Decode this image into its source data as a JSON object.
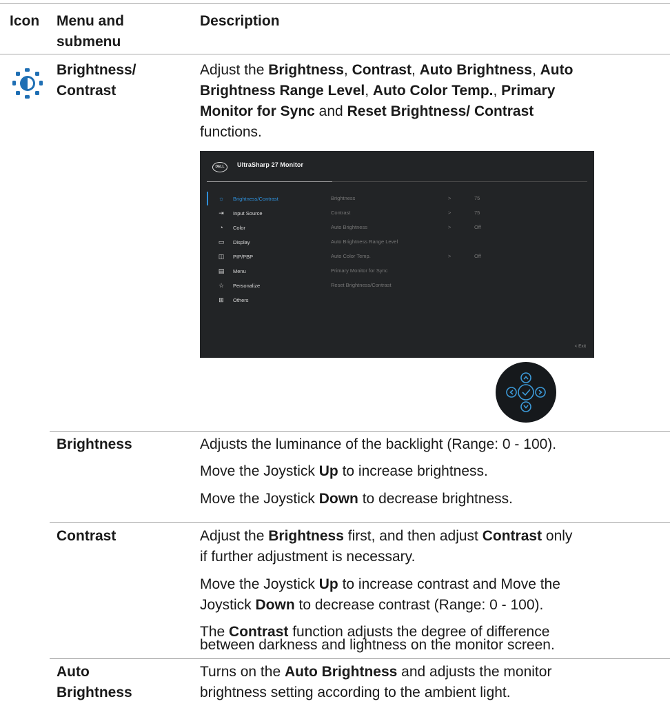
{
  "table": {
    "header_icon": "Icon",
    "header_menu": "Menu and submenu",
    "header_desc": "Description"
  },
  "main": {
    "icon": "brightness-contrast-icon",
    "name_line1": "Brightness/",
    "name_line2": "Contrast",
    "desc": {
      "l1_a": "Adjust the ",
      "l1_b": "Brightness",
      "l1_c": ", ",
      "l1_d": "Contrast",
      "l1_e": ", ",
      "l1_f": "Auto Brightness",
      "l1_g": ", ",
      "l1_h": "Auto",
      "l2_a": "Brightness Range Level",
      "l2_b": ", ",
      "l2_c": "Auto Color Temp.",
      "l2_d": ", ",
      "l2_e": "Primary",
      "l3_a": "Monitor for Sync",
      "l3_b": " and ",
      "l3_c": "Reset Brightness/ Contrast",
      "l4": "functions."
    }
  },
  "osd": {
    "logo": "DELL",
    "title": "UltraSharp 27 Monitor",
    "menu": [
      {
        "icon": "☼",
        "label": "Brightness/Contrast"
      },
      {
        "icon": "⇥",
        "label": "Input Source"
      },
      {
        "icon": "◔",
        "label": "Color"
      },
      {
        "icon": "▭",
        "label": "Display"
      },
      {
        "icon": "◫",
        "label": "PIP/PBP"
      },
      {
        "icon": "▤",
        "label": "Menu"
      },
      {
        "icon": "☆",
        "label": "Personalize"
      },
      {
        "icon": "⊞",
        "label": "Others"
      }
    ],
    "submenu": [
      {
        "label": "Brightness",
        "arrow": ">",
        "value": "75"
      },
      {
        "label": "Contrast",
        "arrow": ">",
        "value": "75"
      },
      {
        "label": "Auto Brightness",
        "arrow": ">",
        "value": "Off"
      },
      {
        "label": "Auto Brightness Range Level",
        "arrow": "",
        "value": ""
      },
      {
        "label": "Auto Color Temp.",
        "arrow": ">",
        "value": "Off"
      },
      {
        "label": "Primary Monitor for Sync",
        "arrow": "",
        "value": ""
      },
      {
        "label": "Reset Brightness/Contrast",
        "arrow": "",
        "value": ""
      }
    ],
    "exit": "<   Exit",
    "accent": "#2f8fd8"
  },
  "rows": {
    "brightness": {
      "name": "Brightness",
      "d1": "Adjusts the luminance of the backlight (Range: 0 - 100).",
      "d2_a": "Move the Joystick ",
      "d2_b": "Up",
      "d2_c": " to increase brightness.",
      "d3_a": "Move the Joystick ",
      "d3_b": "Down",
      "d3_c": " to decrease brightness."
    },
    "contrast": {
      "name": "Contrast",
      "d1_a": "Adjust the ",
      "d1_b": "Brightness",
      "d1_c": " first, and then adjust ",
      "d1_d": "Contrast",
      "d1_e": " only",
      "d2": "if further adjustment is necessary.",
      "d3_a": "Move the Joystick ",
      "d3_b": "Up",
      "d3_c": " to increase contrast and Move the",
      "d4_a": "Joystick ",
      "d4_b": "Down",
      "d4_c": " to decrease contrast (Range: 0 - 100).",
      "d5_a": "The ",
      "d5_b": "Contrast",
      "d5_c": " function adjusts the degree of difference",
      "d6": "between darkness and lightness on the monitor screen."
    },
    "auto_brightness": {
      "name_line1": "Auto",
      "name_line2": "Brightness",
      "d1_a": "Turns on the ",
      "d1_b": "Auto Brightness",
      "d1_c": " and adjusts the monitor",
      "d2": "brightness setting according to the ambient light."
    }
  }
}
